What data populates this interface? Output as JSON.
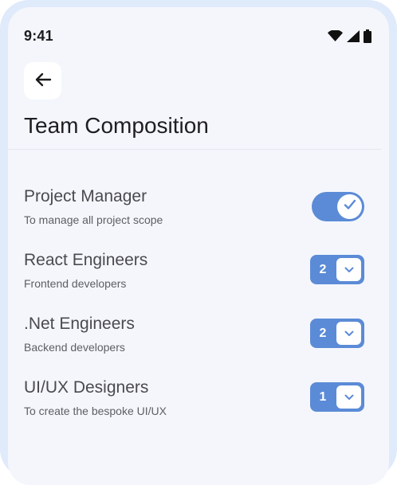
{
  "status_bar": {
    "time": "9:41",
    "icons": [
      "wifi-icon",
      "cellular-signal-icon",
      "battery-icon"
    ]
  },
  "header": {
    "back_icon": "arrow-left-icon",
    "title": "Team Composition"
  },
  "roles": [
    {
      "title": "Project Manager",
      "subtitle": "To manage all project scope",
      "control": "toggle",
      "enabled": true
    },
    {
      "title": "React Engineers",
      "subtitle": "Frontend developers",
      "control": "stepper",
      "count": "2"
    },
    {
      "title": ".Net Engineers",
      "subtitle": "Backend developers",
      "control": "stepper",
      "count": "2"
    },
    {
      "title": "UI/UX Designers",
      "subtitle": "To create the bespoke UI/UX",
      "control": "stepper",
      "count": "1"
    }
  ],
  "colors": {
    "accent": "#5b8bd6",
    "frame": "#dfeafb",
    "screen_background": "#f4f6fc",
    "title_text": "#1e1e22",
    "body_text": "#4a4a4f"
  }
}
